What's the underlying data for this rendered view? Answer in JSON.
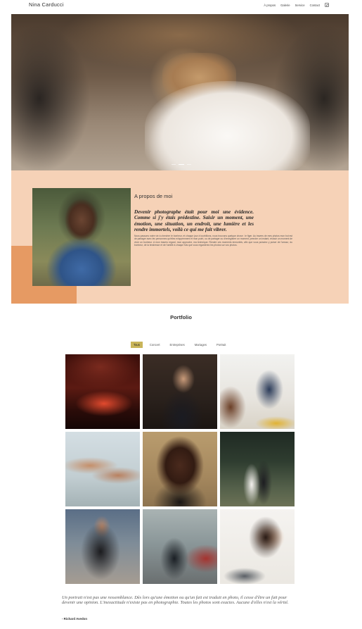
{
  "header": {
    "brand": "Nina Carducci",
    "nav": [
      "À propos",
      "Galerie",
      "Service",
      "Contact"
    ],
    "social_icon": "instagram-icon"
  },
  "hero": {
    "slides": 3,
    "active_slide": 2
  },
  "about": {
    "title": "A propos de moi",
    "lead": "Devenir photographe était pour moi une évidence. Comme si j'y étais prédestine. Saisir un moment, une émotion, une situation, un endroit, une lumière et les rendre immortels, voilà ce qui me fait vibrer.",
    "body": "Nous passons notre vie à chercher le bonheur, et chaque jour à tourbillons, nous trouvons quelque chose : le figer. Au travers de mes photos mon but est de partager avec les personnes qu'elles m'apprennent et mon point, ou de partager ou d'enregistrer un moment, prendre un instant, réussir un moment de vivre un bonheur. A mon travers regard, mon approche, ma technique. Rendre ces moments immortels, afin que vous puissiez y puiser de l'amour, du bonheur, de la tendresse et de l'amitié à chaque fois que vous regarderez les photos sur vos photos."
  },
  "portfolio": {
    "title": "Portfolio",
    "filters": [
      "Tous",
      "Concert",
      "Entreprises",
      "Mariages",
      "Portrait"
    ],
    "active_filter": "Tous",
    "images": [
      {
        "name": "concert-stage-photo"
      },
      {
        "name": "businessman-portrait-photo"
      },
      {
        "name": "business-meeting-photo"
      },
      {
        "name": "hands-touching-photo"
      },
      {
        "name": "man-portrait-photo"
      },
      {
        "name": "wedding-couple-photo"
      },
      {
        "name": "woman-portrait-photo"
      },
      {
        "name": "concert-performer-photo"
      },
      {
        "name": "woman-laptop-photo"
      }
    ]
  },
  "quote": {
    "text": "Un portrait n'est pas une ressemblance. Dès lors qu'une émotion ou qu'un fait est traduit en photo, il cesse d'être un fait pour devenir une opinion. L'inexactitude n'existe pas en photographie. Toutes les photos sont exactes. Aucune d'elles n'est la vérité.",
    "author": "- Richard Avedon"
  }
}
